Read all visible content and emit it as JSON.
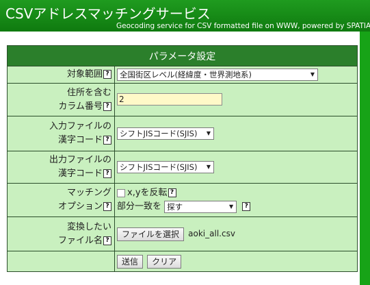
{
  "header": {
    "title": "CSVアドレスマッチングサービス",
    "subtitle": "Geocoding service for CSV formatted file on WWW, powered by SPATIAL"
  },
  "table": {
    "caption": "パラメータ設定",
    "help_symbol": "?",
    "rows": {
      "scope": {
        "label": "対象範囲",
        "value": "全国街区レベル(経緯度・世界測地系)"
      },
      "address_column": {
        "label_line1": "住所を含む",
        "label_line2": "カラム番号",
        "value": "2"
      },
      "input_encoding": {
        "label_line1": "入力ファイルの",
        "label_line2": "漢字コード",
        "value": "シフトJISコード(SJIS)"
      },
      "output_encoding": {
        "label_line1": "出力ファイルの",
        "label_line2": "漢字コード",
        "value": "シフトJISコード(SJIS)"
      },
      "matching_option": {
        "label_line1": "マッチング",
        "label_line2": "オプション",
        "xy_swap_label": "x,yを反転",
        "partial_match_label": "部分一致を",
        "partial_match_value": "探す"
      },
      "file": {
        "label_line1": "変換したい",
        "label_line2": "ファイル名",
        "choose_button": "ファイルを選択",
        "chosen_file": "aoki_all.csv"
      },
      "actions": {
        "submit": "送信",
        "clear": "クリア"
      }
    }
  }
}
